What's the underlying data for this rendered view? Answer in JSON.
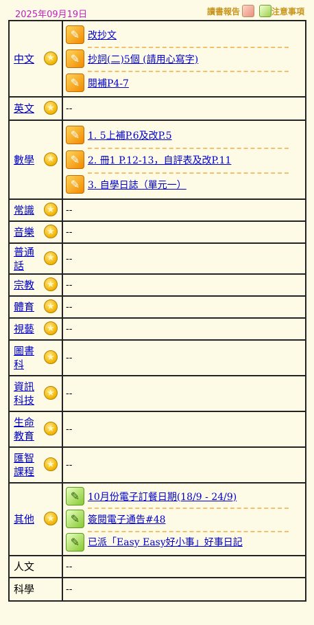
{
  "header": {
    "date": "2025年09月19日",
    "reading_report_label": "讀書報告",
    "notice_label": "注意事項"
  },
  "subjects": [
    {
      "name": "中文",
      "linked": true,
      "items": [
        "改抄文",
        "抄詞(二)5個 (請用心寫字)",
        "閱補P4-7"
      ]
    },
    {
      "name": "英文",
      "linked": true,
      "empty": "--"
    },
    {
      "name": "數學",
      "linked": true,
      "items": [
        "1. 5上補P.6及改P.5",
        "2. 冊1 P.12-13，自評表及改P.11",
        "3. 自學日誌（單元一）"
      ]
    },
    {
      "name": "常識",
      "linked": true,
      "empty": "--"
    },
    {
      "name": "音樂",
      "linked": true,
      "empty": "--"
    },
    {
      "name": "普通話",
      "linked": true,
      "empty": "--"
    },
    {
      "name": "宗教",
      "linked": true,
      "empty": "--"
    },
    {
      "name": "體育",
      "linked": true,
      "empty": "--"
    },
    {
      "name": "視藝",
      "linked": true,
      "empty": "--"
    },
    {
      "name": "圖書科",
      "linked": true,
      "empty": "--"
    },
    {
      "name": "資訊科技",
      "linked": true,
      "empty": "--"
    },
    {
      "name": "生命教育",
      "linked": true,
      "empty": "--"
    },
    {
      "name": "匯智課程",
      "linked": true,
      "empty": "--"
    },
    {
      "name": "其他",
      "linked": true,
      "items": [
        "10月份電子訂餐日期(18/9 - 24/9)",
        "簽閱電子通告#48",
        "已派「Easy Easy好小事」好事日記"
      ]
    },
    {
      "name": "人文",
      "linked": false,
      "empty": "--"
    },
    {
      "name": "科學",
      "linked": false,
      "empty": "--"
    }
  ],
  "icons": {
    "star": "star-icon",
    "homework": "pencil-icon",
    "notice": "notice-pencil-icon"
  },
  "colors": {
    "date": "#c020c0",
    "link": "#0000cc",
    "tool_label": "#c8961e",
    "background": "#fdfae6"
  }
}
